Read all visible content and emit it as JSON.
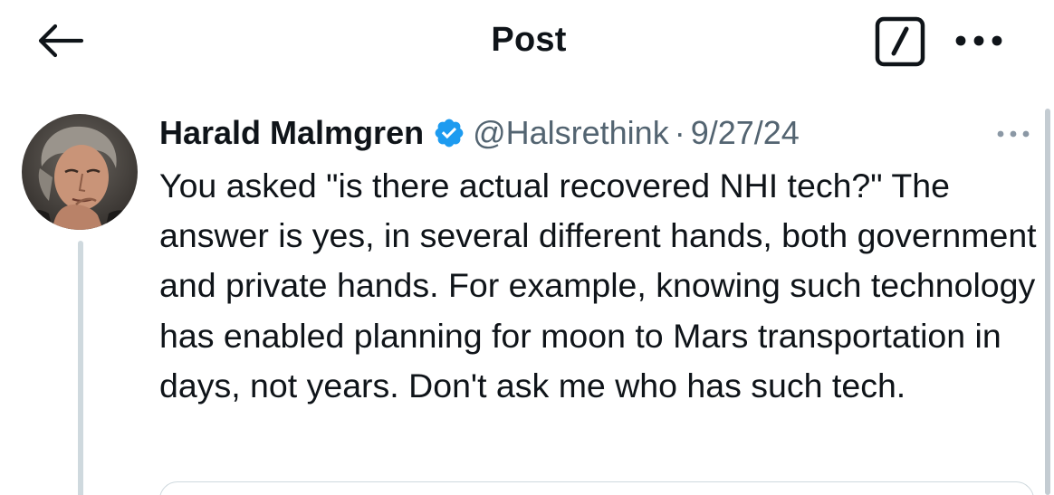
{
  "header": {
    "title": "Post",
    "back_icon": "arrow-left-icon",
    "edit_icon": "edit-square-icon",
    "more_icon": "more-horizontal-icon"
  },
  "post": {
    "author_name": "Harald Malmgren",
    "verified_icon": "verified-badge-icon",
    "verified_color": "#1d9bf0",
    "handle": "@Halsrethink",
    "separator": "·",
    "date": "9/27/24",
    "more_icon": "more-horizontal-icon",
    "text": "You asked \"is there actual recovered NHI tech?\" The answer is yes, in several different hands, both government and private hands. For example, knowing such technology has enabled planning for moon to Mars transportation in days, not years. Don't ask me who has such tech."
  },
  "colors": {
    "text_primary": "#0f1419",
    "text_secondary": "#536471",
    "thread_line": "#cfd9de",
    "accent": "#1d9bf0"
  }
}
